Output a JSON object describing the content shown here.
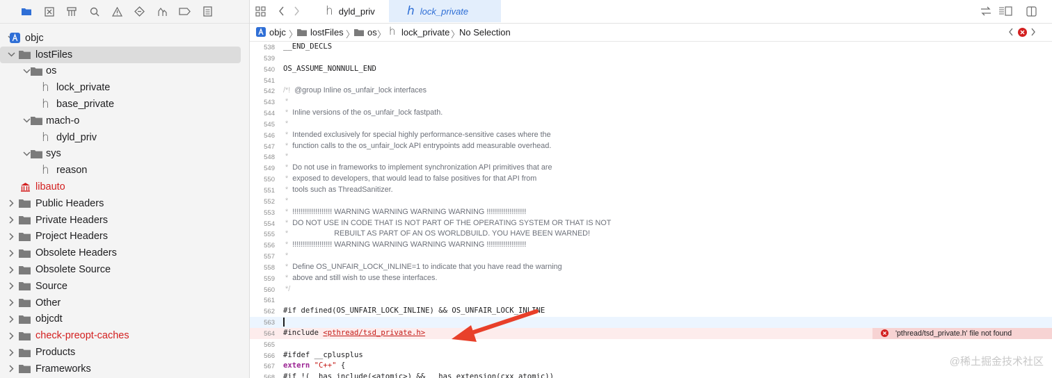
{
  "navigator": {
    "tree": [
      {
        "label": "objc",
        "level": 0,
        "disc": "down",
        "icon": "project-icon",
        "red": false,
        "sel": false
      },
      {
        "label": "lostFiles",
        "level": 0,
        "disc": "down",
        "icon": "folder-icon",
        "red": false,
        "sel": true
      },
      {
        "label": "os",
        "level": 1,
        "disc": "down",
        "icon": "folder-icon",
        "red": false,
        "sel": false
      },
      {
        "label": "lock_private",
        "level": 2,
        "disc": "",
        "icon": "header-file-icon",
        "red": false,
        "sel": false
      },
      {
        "label": "base_private",
        "level": 2,
        "disc": "",
        "icon": "header-file-icon",
        "red": false,
        "sel": false
      },
      {
        "label": "mach-o",
        "level": 1,
        "disc": "down",
        "icon": "folder-icon",
        "red": false,
        "sel": false
      },
      {
        "label": "dyld_priv",
        "level": 2,
        "disc": "",
        "icon": "header-file-icon",
        "red": false,
        "sel": false
      },
      {
        "label": "sys",
        "level": 1,
        "disc": "down",
        "icon": "folder-icon",
        "red": false,
        "sel": false
      },
      {
        "label": "reason",
        "level": 2,
        "disc": "",
        "icon": "header-file-icon",
        "red": false,
        "sel": false
      },
      {
        "label": "libauto",
        "level": 0,
        "disc": "",
        "icon": "library-icon",
        "red": true,
        "sel": false
      },
      {
        "label": "Public Headers",
        "level": 0,
        "disc": "right",
        "icon": "folder-icon",
        "red": false,
        "sel": false
      },
      {
        "label": "Private Headers",
        "level": 0,
        "disc": "right",
        "icon": "folder-icon",
        "red": false,
        "sel": false
      },
      {
        "label": "Project Headers",
        "level": 0,
        "disc": "right",
        "icon": "folder-icon",
        "red": false,
        "sel": false
      },
      {
        "label": "Obsolete Headers",
        "level": 0,
        "disc": "right",
        "icon": "folder-icon",
        "red": false,
        "sel": false
      },
      {
        "label": "Obsolete Source",
        "level": 0,
        "disc": "right",
        "icon": "folder-icon",
        "red": false,
        "sel": false
      },
      {
        "label": "Source",
        "level": 0,
        "disc": "right",
        "icon": "folder-icon",
        "red": false,
        "sel": false
      },
      {
        "label": "Other",
        "level": 0,
        "disc": "right",
        "icon": "folder-icon",
        "red": false,
        "sel": false
      },
      {
        "label": "objcdt",
        "level": 0,
        "disc": "right",
        "icon": "folder-icon",
        "red": false,
        "sel": false
      },
      {
        "label": "check-preopt-caches",
        "level": 0,
        "disc": "right",
        "icon": "folder-icon",
        "red": true,
        "sel": false
      },
      {
        "label": "Products",
        "level": 0,
        "disc": "right",
        "icon": "folder-icon",
        "red": false,
        "sel": false
      },
      {
        "label": "Frameworks",
        "level": 0,
        "disc": "right",
        "icon": "folder-icon",
        "red": false,
        "sel": false
      }
    ]
  },
  "tabs": [
    {
      "label": "dyld_priv",
      "active": false
    },
    {
      "label": "lock_private",
      "active": true
    }
  ],
  "jumpbar": {
    "items": [
      "objc",
      "lostFiles",
      "os",
      "lock_private",
      "No Selection"
    ]
  },
  "code": {
    "lines": [
      {
        "n": "538",
        "t": "__END_DECLS",
        "k": "code"
      },
      {
        "n": "539",
        "t": "",
        "k": "code"
      },
      {
        "n": "540",
        "t": "OS_ASSUME_NONNULL_END",
        "k": "code"
      },
      {
        "n": "541",
        "t": "",
        "k": "code"
      },
      {
        "n": "542",
        "t": "@group Inline os_unfair_lock interfaces",
        "k": "cstart"
      },
      {
        "n": "543",
        "t": "",
        "k": "comment"
      },
      {
        "n": "544",
        "t": "Inline versions of the os_unfair_lock fastpath.",
        "k": "comment"
      },
      {
        "n": "545",
        "t": "",
        "k": "comment"
      },
      {
        "n": "546",
        "t": "Intended exclusively for special highly performance-sensitive cases where the",
        "k": "comment"
      },
      {
        "n": "547",
        "t": "function calls to the os_unfair_lock API entrypoints add measurable overhead.",
        "k": "comment"
      },
      {
        "n": "548",
        "t": "",
        "k": "comment"
      },
      {
        "n": "549",
        "t": "Do not use in frameworks to implement synchronization API primitives that are",
        "k": "comment"
      },
      {
        "n": "550",
        "t": "exposed to developers, that would lead to false positives for that API from",
        "k": "comment"
      },
      {
        "n": "551",
        "t": "tools such as ThreadSanitizer.",
        "k": "comment"
      },
      {
        "n": "552",
        "t": "",
        "k": "comment"
      },
      {
        "n": "553",
        "t": "!!!!!!!!!!!!!!!!!!! WARNING WARNING WARNING WARNING !!!!!!!!!!!!!!!!!!!",
        "k": "comment"
      },
      {
        "n": "554",
        "t": "DO NOT USE IN CODE THAT IS NOT PART OF THE OPERATING SYSTEM OR THAT IS NOT",
        "k": "comment"
      },
      {
        "n": "555",
        "t": "                    REBUILT AS PART OF AN OS WORLDBUILD. YOU HAVE BEEN WARNED!",
        "k": "comment"
      },
      {
        "n": "556",
        "t": "!!!!!!!!!!!!!!!!!!! WARNING WARNING WARNING WARNING !!!!!!!!!!!!!!!!!!!",
        "k": "comment"
      },
      {
        "n": "557",
        "t": "",
        "k": "comment"
      },
      {
        "n": "558",
        "t": "Define OS_UNFAIR_LOCK_INLINE=1 to indicate that you have read the warning",
        "k": "comment"
      },
      {
        "n": "559",
        "t": "above and still wish to use these interfaces.",
        "k": "comment"
      },
      {
        "n": "560",
        "t": "",
        "k": "cend"
      },
      {
        "n": "561",
        "t": "",
        "k": "code"
      },
      {
        "n": "562",
        "t": "#if defined(OS_UNFAIR_LOCK_INLINE) && OS_UNFAIR_LOCK_INLINE",
        "k": "code"
      },
      {
        "n": "563",
        "t": "",
        "k": "cursor"
      },
      {
        "n": "564",
        "t": "#include ",
        "t2": "<pthread/tsd_private.h>",
        "k": "error"
      },
      {
        "n": "565",
        "t": "",
        "k": "code"
      },
      {
        "n": "566",
        "t": "#ifdef __cplusplus",
        "k": "code"
      },
      {
        "n": "567",
        "t": "extern ",
        "t2": "\"C++\"",
        "t3": " {",
        "k": "extern"
      },
      {
        "n": "568",
        "t": "#if !(__has_include(<atomic>) && __has_extension(cxx_atomic))",
        "k": "code"
      }
    ],
    "error_message": "'pthread/tsd_private.h' file not found"
  },
  "watermark": "@稀土掘金技术社区",
  "colors": {
    "accent": "#2f6fd6",
    "error": "#d32020",
    "comment": "#6c7079"
  }
}
